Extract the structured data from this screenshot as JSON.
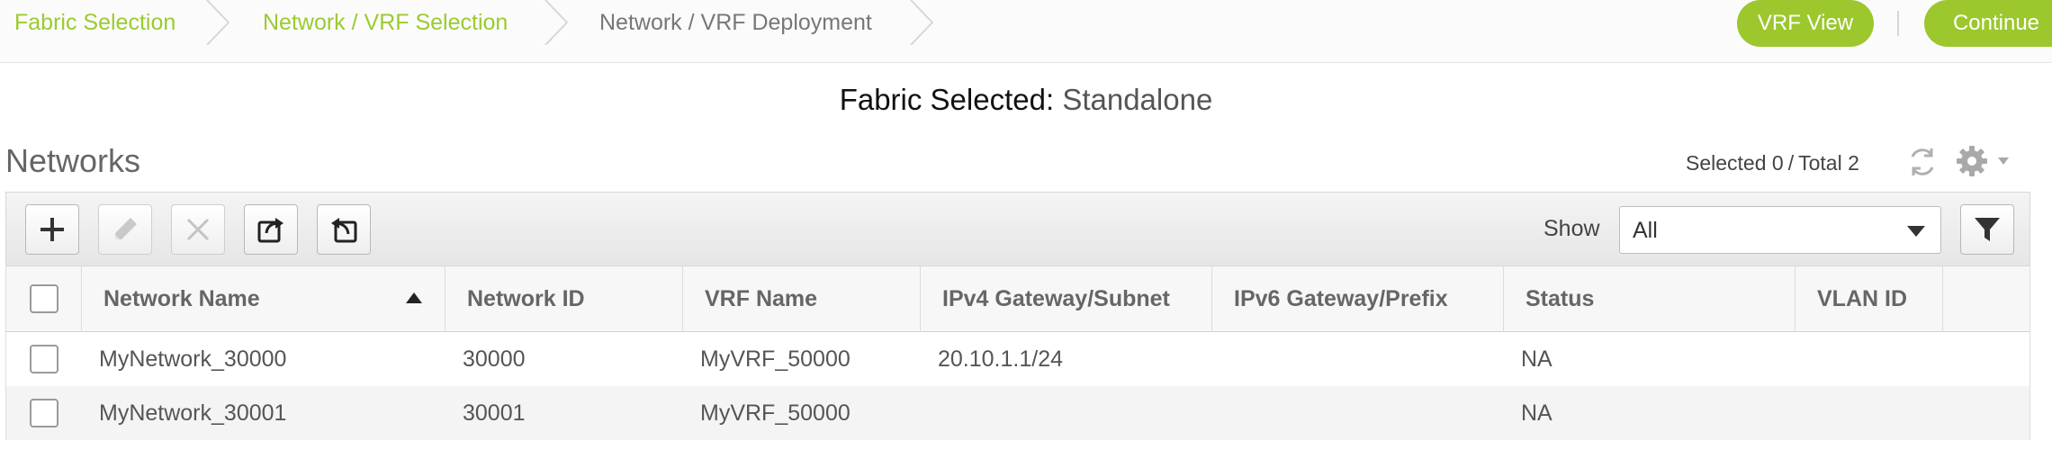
{
  "breadcrumb": [
    {
      "label": "Fabric Selection",
      "state": "done"
    },
    {
      "label": "Network / VRF Selection",
      "state": "done"
    },
    {
      "label": "Network / VRF Deployment",
      "state": "current"
    }
  ],
  "header_actions": {
    "vrf_view_label": "VRF View",
    "continue_label": "Continue"
  },
  "fabric": {
    "label": "Fabric Selected:",
    "value": "Standalone"
  },
  "networks": {
    "title": "Networks",
    "selected_label": "Selected",
    "selected_count": "0",
    "separator": "/",
    "total_label": "Total",
    "total_count": "2"
  },
  "toolbar": {
    "buttons": [
      {
        "icon": "plus-icon",
        "enabled": true
      },
      {
        "icon": "pencil-icon",
        "enabled": false
      },
      {
        "icon": "x-icon",
        "enabled": false
      },
      {
        "icon": "export-icon",
        "enabled": true
      },
      {
        "icon": "import-icon",
        "enabled": true
      }
    ],
    "show_label": "Show",
    "show_value": "All"
  },
  "table": {
    "columns": [
      "Network Name",
      "Network ID",
      "VRF Name",
      "IPv4 Gateway/Subnet",
      "IPv6 Gateway/Prefix",
      "Status",
      "VLAN ID"
    ],
    "sorted_column": "Network Name",
    "sort_direction": "ascending",
    "rows": [
      {
        "network_name": "MyNetwork_30000",
        "network_id": "30000",
        "vrf_name": "MyVRF_50000",
        "ipv4": "20.10.1.1/24",
        "ipv6": "",
        "status": "NA",
        "vlan_id": ""
      },
      {
        "network_name": "MyNetwork_30001",
        "network_id": "30001",
        "vrf_name": "MyVRF_50000",
        "ipv4": "",
        "ipv6": "",
        "status": "NA",
        "vlan_id": ""
      }
    ]
  },
  "colors": {
    "accent_green": "#9cc72d",
    "breadcrumb_done": "#9acb2f",
    "breadcrumb_current": "#777777"
  }
}
